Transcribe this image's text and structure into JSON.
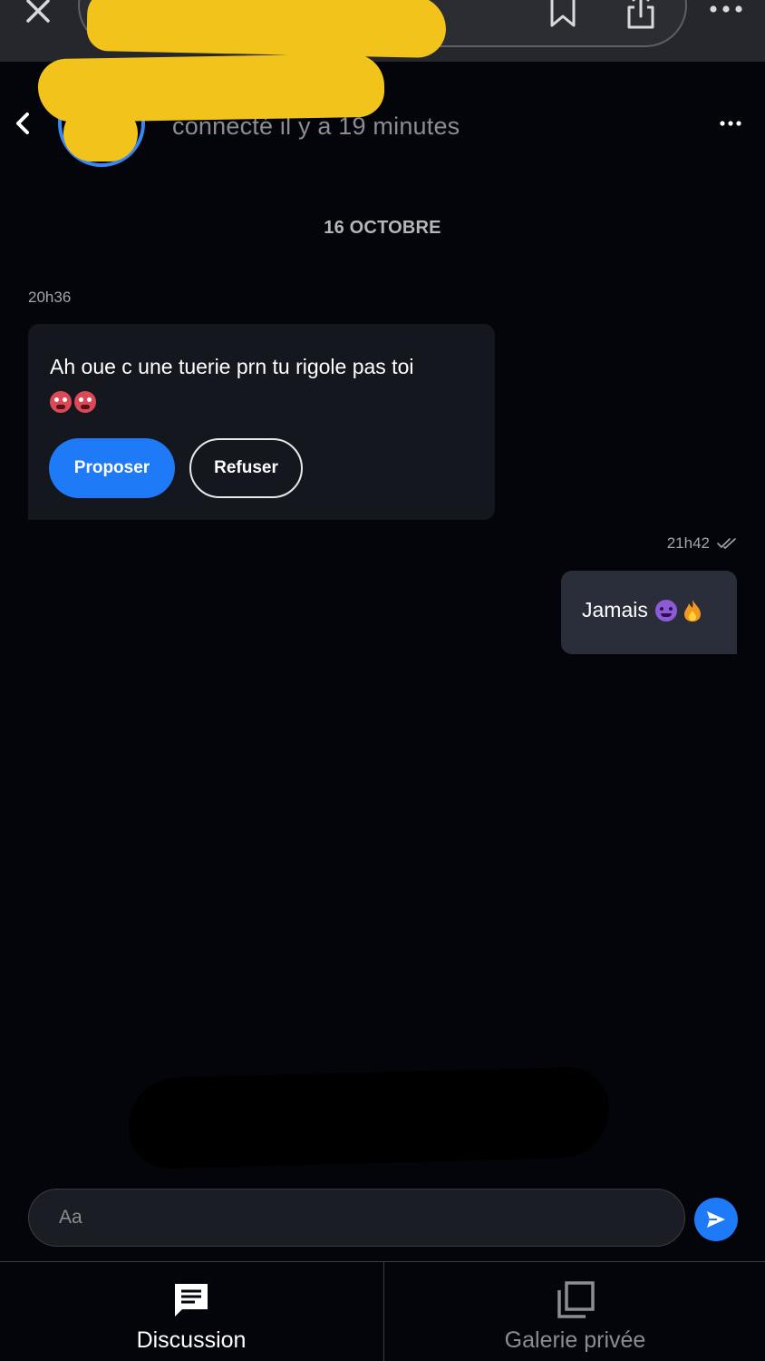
{
  "browser": {
    "close_icon": "close-icon",
    "bookmark_icon": "bookmark-icon",
    "share_icon": "share-icon",
    "more_icon": "more-horizontal-icon"
  },
  "header": {
    "status": "connecté il y a 19 minutes",
    "back_icon": "chevron-left-icon",
    "menu_icon": "more-horizontal-icon"
  },
  "conversation": {
    "date_separator": "16 OCTOBRE",
    "messages": [
      {
        "direction": "incoming",
        "time": "20h36",
        "text": "Ah oue c une tuerie prn tu rigole pas toi",
        "emojis": [
          "hot-face-emoji",
          "hot-face-emoji"
        ],
        "actions": [
          {
            "label": "Proposer",
            "style": "primary"
          },
          {
            "label": "Refuser",
            "style": "outline"
          }
        ]
      },
      {
        "direction": "outgoing",
        "time": "21h42",
        "read_receipt_icon": "double-check-icon",
        "text": "Jamais",
        "emojis": [
          "smiling-devil-emoji",
          "fire-emoji"
        ]
      }
    ]
  },
  "composer": {
    "placeholder": "Aa",
    "send_icon": "send-icon"
  },
  "tabs": [
    {
      "label": "Discussion",
      "icon": "chat-icon",
      "active": true
    },
    {
      "label": "Galerie privée",
      "icon": "gallery-icon",
      "active": false
    }
  ],
  "colors": {
    "background": "#04050a",
    "accent": "#1f7af7",
    "incoming_bubble": "#15171f",
    "outgoing_bubble": "#2a2e3b",
    "redaction": "#f2c31a"
  }
}
